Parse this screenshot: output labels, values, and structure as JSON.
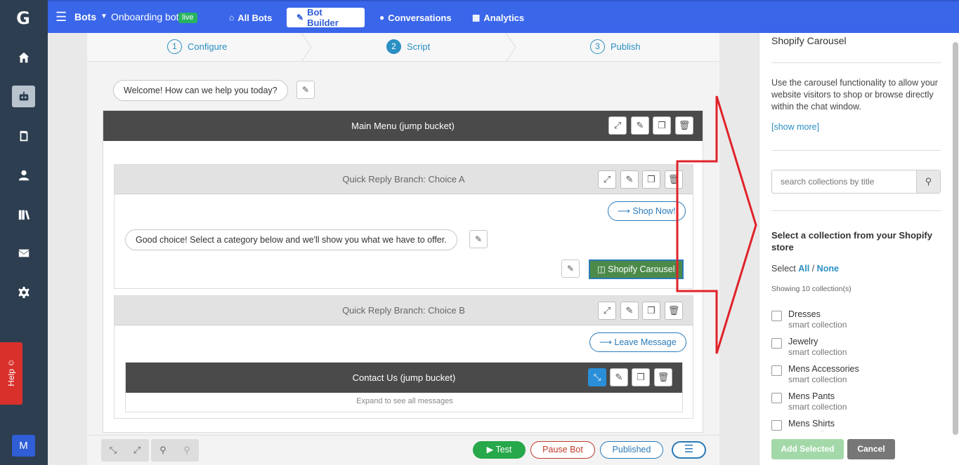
{
  "nav": {
    "bots_label": "Bots",
    "bot_name": "Onboarding bot",
    "live_badge": "live",
    "tabs": [
      {
        "label": "All Bots",
        "icon": "home-icon"
      },
      {
        "label": "Bot Builder",
        "icon": "pencil-icon"
      },
      {
        "label": "Conversations",
        "icon": "chat-bubble-icon"
      },
      {
        "label": "Analytics",
        "icon": "bar-chart-icon"
      }
    ],
    "active_tab": "Bot Builder"
  },
  "sidebar": {
    "items": [
      "home-icon",
      "robot-icon",
      "book-icon",
      "user-icon",
      "library-icon",
      "mail-icon",
      "gear-icon"
    ],
    "active_item": "robot-icon",
    "help_label": "Help",
    "avatar_letter": "M"
  },
  "steps": [
    {
      "num": "1",
      "label": "Configure"
    },
    {
      "num": "2",
      "label": "Script"
    },
    {
      "num": "3",
      "label": "Publish"
    }
  ],
  "active_step": "Script",
  "script": {
    "welcome": "Welcome! How can we help you today?",
    "main_menu": "Main Menu (jump bucket)",
    "choice_a": {
      "title": "Quick Reply Branch: Choice A",
      "reply_button": "⟶ Shop Now!",
      "message": "Good choice! Select a category below and we'll show you what we have to offer.",
      "carousel_button": "Shopify Carousel"
    },
    "choice_b": {
      "title": "Quick Reply Branch: Choice B",
      "reply_button": "⟶ Leave Message",
      "contact_bucket": "Contact Us (jump bucket)",
      "expand_note": "Expand to see all messages"
    }
  },
  "toolbar": {
    "test": "Test",
    "pause_bot": "Pause Bot",
    "published": "Published"
  },
  "panel": {
    "title": "Shopify Carousel",
    "description": "Use the carousel functionality to allow your website visitors to shop or browse directly within the chat window.",
    "show_more": "[show more]",
    "search_placeholder": "search collections by title",
    "heading": "Select a collection from your Shopify store",
    "select_prefix": "Select",
    "select_all": "All",
    "select_sep": "/",
    "select_none": "None",
    "count_text": "Showing 10 collection(s)",
    "collections": [
      {
        "name": "Dresses",
        "type": "smart collection"
      },
      {
        "name": "Jewelry",
        "type": "smart collection"
      },
      {
        "name": "Mens Accessories",
        "type": "smart collection"
      },
      {
        "name": "Mens Pants",
        "type": "smart collection"
      },
      {
        "name": "Mens Shirts",
        "type": "smart collection"
      }
    ],
    "add_selected": "Add Selected",
    "cancel": "Cancel"
  },
  "colors": {
    "topbar": "#3a66ea",
    "sidebar": "#2d3e50",
    "accent": "#2a8fc2",
    "green": "#27b35f",
    "red": "#d9302c"
  }
}
